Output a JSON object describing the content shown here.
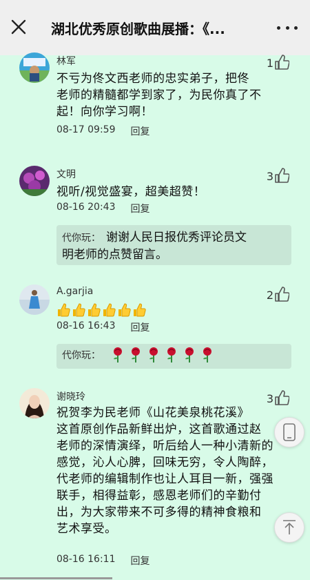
{
  "header": {
    "title": "湖北优秀原创歌曲展播：《..."
  },
  "comments": [
    {
      "name": "林军",
      "likes": "1",
      "lines": [
        "不亏为佟文西老师的忠实弟子，把佟",
        "老师的精髓都学到家了，为民你真了不",
        "起！向你学习啊！"
      ],
      "time": "08-17 09:59",
      "reply": "回复"
    },
    {
      "name": "文明",
      "likes": "3",
      "lines": [
        "视听/视觉盛宴，超美超赞！"
      ],
      "time": "08-16 20:43",
      "reply": "回复",
      "author_reply": {
        "name": "代你玩：",
        "line1": "谢谢人民日报优秀评论员文",
        "line2": "明老师的点赞留言。"
      }
    },
    {
      "name": "A.garjia",
      "likes": "2",
      "thumbs_count": 6,
      "time": "08-16 16:43",
      "reply": "回复",
      "author_reply": {
        "name": "代你玩："
      }
    },
    {
      "name": "谢晓玲",
      "likes": "3",
      "lines": [
        "祝贺李为民老师《山花美泉桃花溪》",
        "这首原创作品新鲜出炉，这首歌通过赵",
        "老师的深情演绎，听后给人一种小清新的",
        "感觉，沁人心脾，回味无穷，令人陶醉，",
        "代老师的编辑制作也让人耳目一新，强强",
        "联手，相得益彰，感恩老师们的辛勤付",
        "出，为大家带来不可多得的精神食粮和",
        "艺术享受。"
      ],
      "time": "08-16 16:11",
      "reply": "回复"
    }
  ],
  "colors": {
    "background": "#d8fbe8",
    "header": "#efefef",
    "reply_box": "#c8e6d6"
  }
}
